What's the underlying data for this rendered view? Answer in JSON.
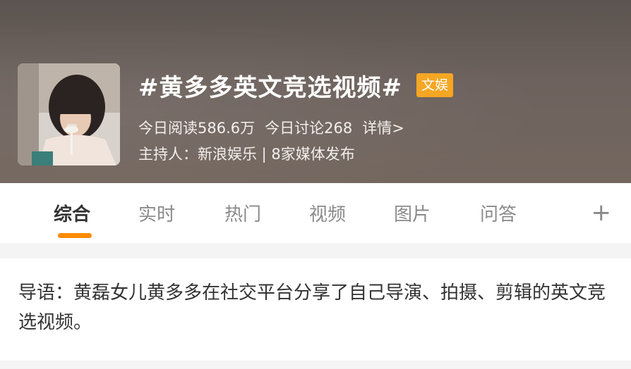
{
  "topic": {
    "title": "#黄多多英文竞选视频#",
    "tag": "文娱",
    "reads": "今日阅读586.6万",
    "discussions": "今日讨论268",
    "details_link": "详情>",
    "host": "主持人：新浪娱乐 | 8家媒体发布"
  },
  "tabs": [
    {
      "label": "综合",
      "active": true
    },
    {
      "label": "实时",
      "active": false
    },
    {
      "label": "热门",
      "active": false
    },
    {
      "label": "视频",
      "active": false
    },
    {
      "label": "图片",
      "active": false
    },
    {
      "label": "问答",
      "active": false
    }
  ],
  "add_tab_symbol": "+",
  "intro": {
    "text": "导语：黄磊女儿黄多多在社交平台分享了自己导演、拍摄、剪辑的英文竞选视频。"
  },
  "colors": {
    "tag_bg": "#f5a623",
    "active_underline": "#ff8a00",
    "header_bg": "#6a605b"
  }
}
